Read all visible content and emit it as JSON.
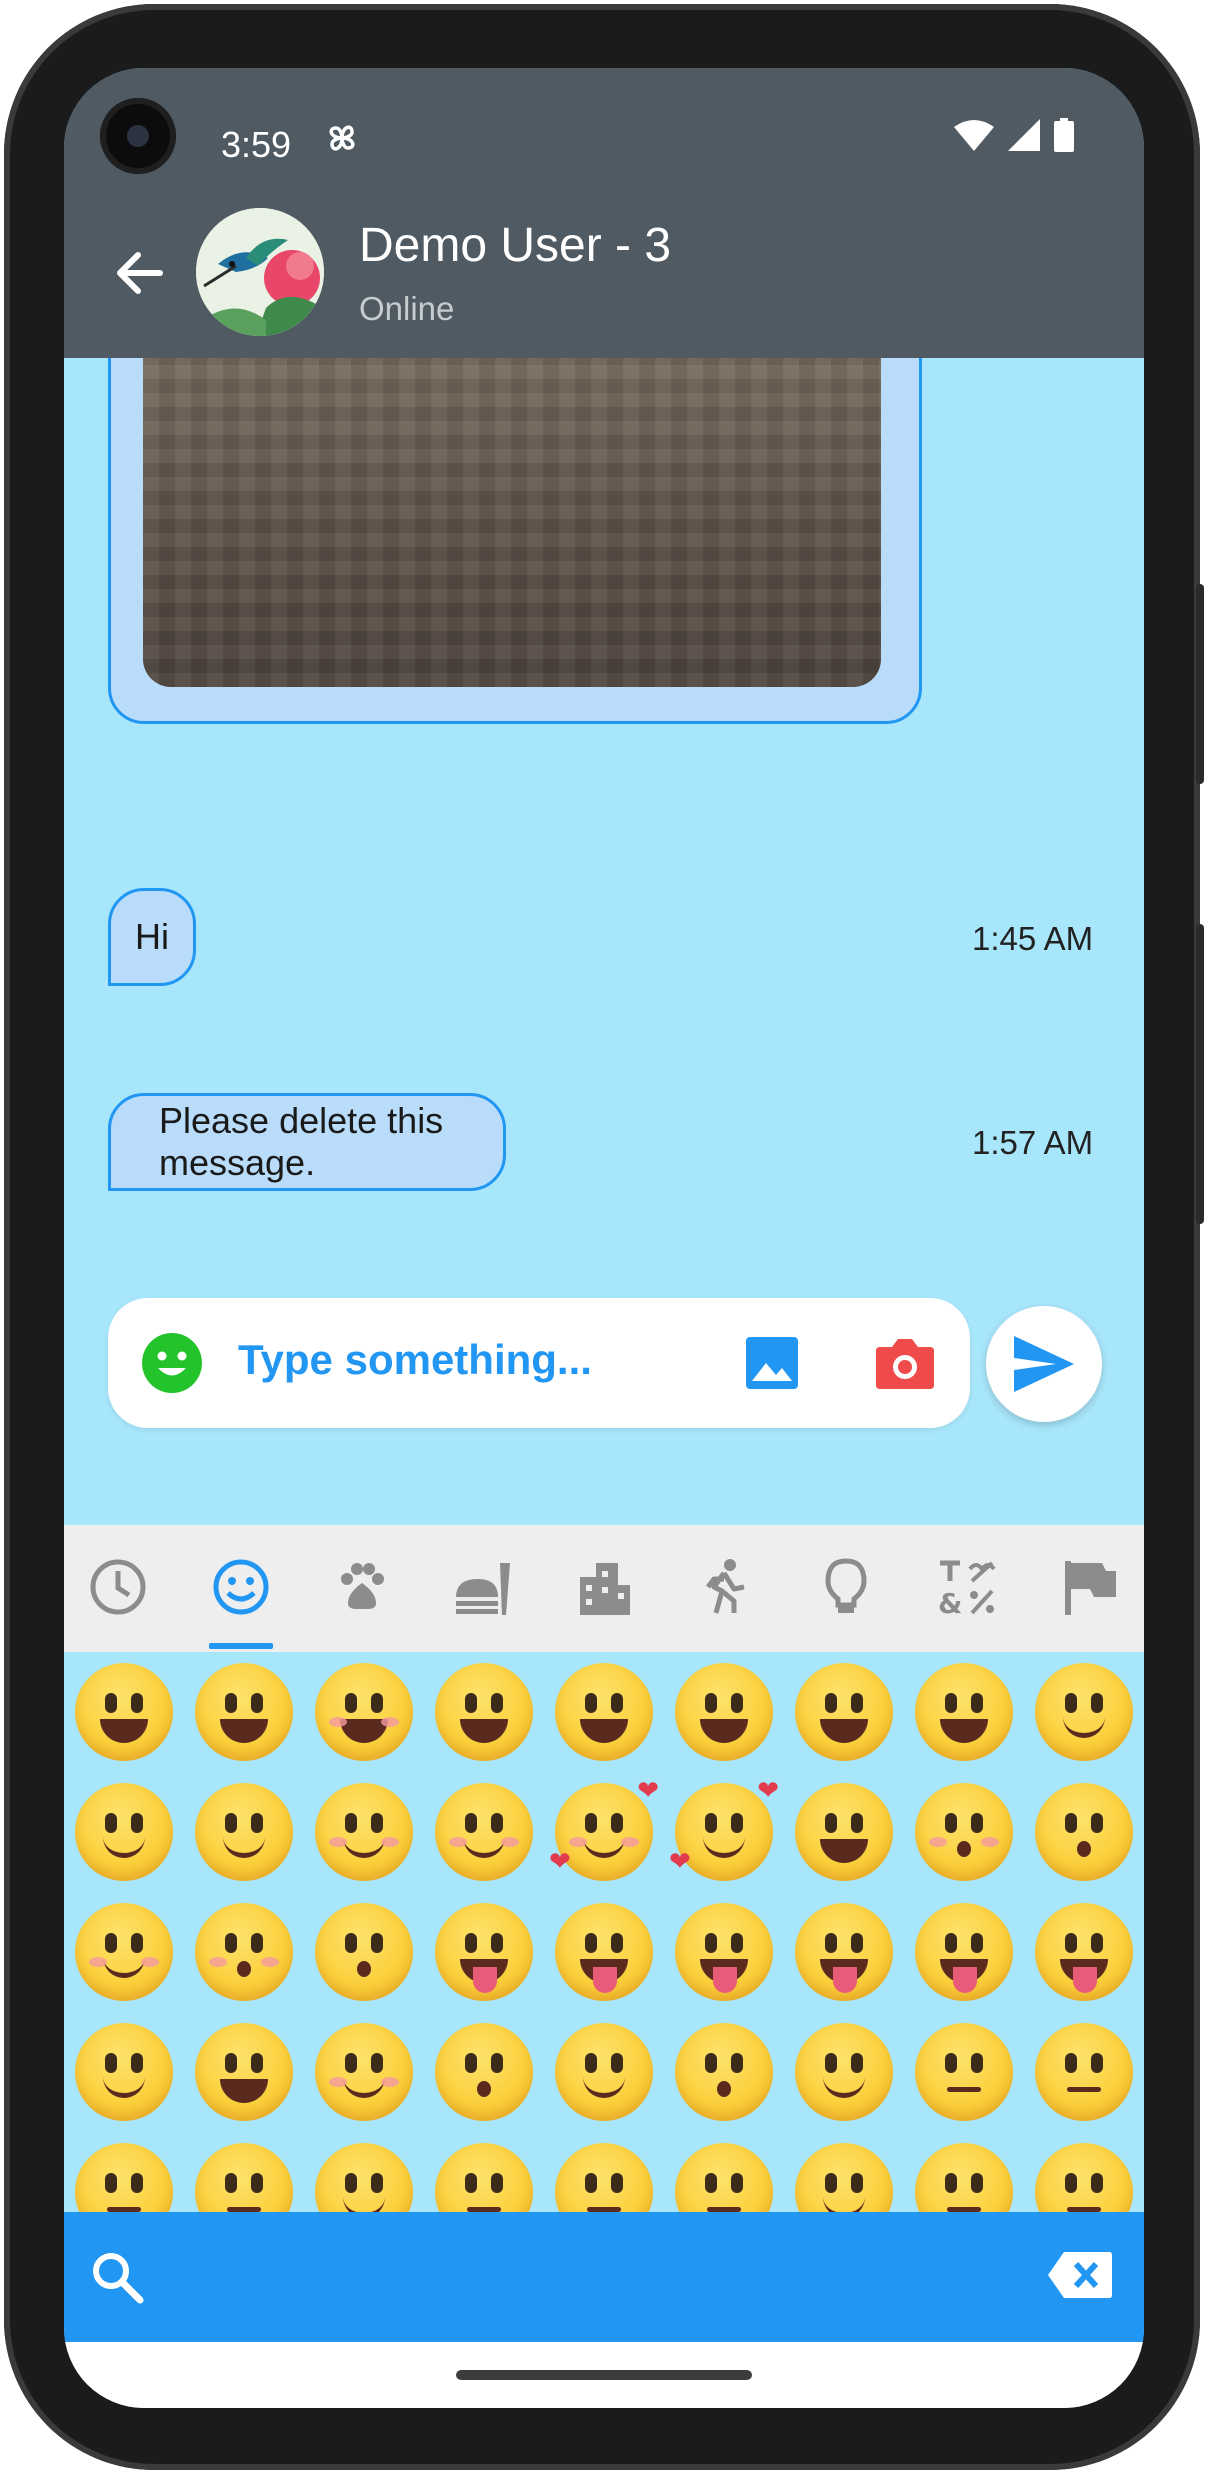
{
  "status_bar": {
    "time": "3:59"
  },
  "header": {
    "contact_name": "Demo User - 3",
    "contact_status": "Online"
  },
  "messages": [
    {
      "text": "Hi",
      "time": "1:45 AM"
    },
    {
      "text": "Please delete this message.",
      "time": "1:57 AM"
    }
  ],
  "composer": {
    "placeholder": "Type something..."
  },
  "emoji_picker": {
    "categories": [
      "recent-icon",
      "smileys-icon",
      "animals-icon",
      "food-icon",
      "travel-icon",
      "activity-icon",
      "objects-icon",
      "symbols-icon",
      "flags-icon"
    ],
    "selected_category": "smileys-icon",
    "emojis": [
      "😀",
      "😃",
      "😄",
      "😁",
      "😆",
      "😅",
      "🤣",
      "😂",
      "🙂",
      "🙃",
      "😉",
      "😊",
      "😇",
      "🥰",
      "😍",
      "🤩",
      "😘",
      "😗",
      "☺️",
      "😚",
      "😙",
      "😋",
      "😛",
      "😜",
      "🤪",
      "😝",
      "🤑",
      "🤗",
      "🫣",
      "🤭",
      "🫢",
      "🫡",
      "🤫",
      "🫠",
      "🤔",
      "🤐",
      "🤨",
      "😐",
      "😏",
      "😑",
      "😶",
      "🫥",
      "😏",
      "😒",
      "🙄"
    ]
  },
  "colors": {
    "accent": "#2196f3",
    "chat_background": "#a8e6fb",
    "app_bar": "#4f5a62",
    "bubble": "#b9dcfa",
    "emoji_button": "#22c32b",
    "camera_button": "#f04b4b"
  }
}
